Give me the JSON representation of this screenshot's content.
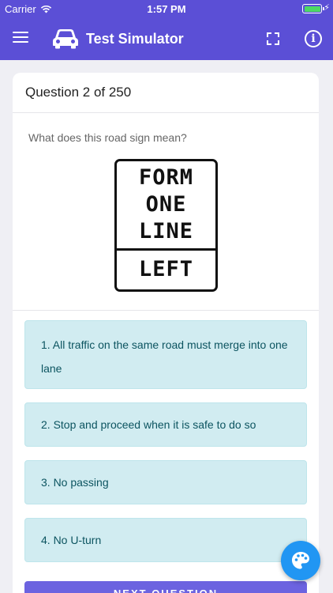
{
  "status_bar": {
    "carrier": "Carrier",
    "time": "1:57 PM",
    "battery_level": 1.0,
    "charging": true
  },
  "app_bar": {
    "title": "Test Simulator",
    "icons": [
      "menu-icon",
      "car-icon",
      "fullscreen-icon",
      "info-icon"
    ],
    "info_glyph": "i"
  },
  "question": {
    "header": "Question 2 of 250",
    "text": "What does this road sign mean?",
    "sign": {
      "lines": [
        "FORM",
        "ONE",
        "LINE"
      ],
      "bottom": "LEFT"
    }
  },
  "answers": [
    {
      "label": "1. All traffic on the same road must merge into one lane"
    },
    {
      "label": "2. Stop and proceed when it is safe to do so"
    },
    {
      "label": "3. No passing"
    },
    {
      "label": "4. No U-turn"
    }
  ],
  "next_button": {
    "label": "NEXT QUESTION"
  },
  "fab": {
    "icon": "palette-icon"
  },
  "colors": {
    "primary": "#5b4fd6",
    "answer_bg": "#d1ecf1",
    "answer_text": "#0c5460",
    "fab": "#2196f3"
  }
}
